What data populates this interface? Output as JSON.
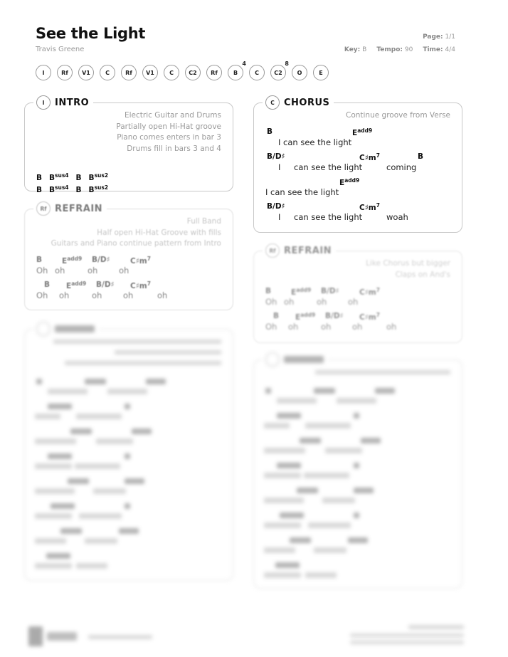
{
  "song": {
    "title": "See the Light",
    "artist": "Travis Greene"
  },
  "meta": {
    "page_label": "Page:",
    "page_value": "1/1",
    "key_label": "Key:",
    "key_value": "B",
    "tempo_label": "Tempo:",
    "tempo_value": "90",
    "time_label": "Time:",
    "time_value": "4/4"
  },
  "roadmap": [
    {
      "label": "I",
      "repeat": ""
    },
    {
      "label": "Rf",
      "repeat": ""
    },
    {
      "label": "V1",
      "repeat": ""
    },
    {
      "label": "C",
      "repeat": ""
    },
    {
      "label": "Rf",
      "repeat": ""
    },
    {
      "label": "V1",
      "repeat": ""
    },
    {
      "label": "C",
      "repeat": ""
    },
    {
      "label": "C2",
      "repeat": ""
    },
    {
      "label": "Rf",
      "repeat": ""
    },
    {
      "label": "B",
      "repeat": "4"
    },
    {
      "label": "C",
      "repeat": ""
    },
    {
      "label": "C2",
      "repeat": "8"
    },
    {
      "label": "O",
      "repeat": ""
    },
    {
      "label": "E",
      "repeat": ""
    }
  ],
  "sections": {
    "intro": {
      "badge": "I",
      "title": "INTRO",
      "notes": [
        "Electric Guitar and Drums",
        "Partially open Hi-Hat groove",
        "Piano comes enters in bar 3",
        "Drums fill in bars 3 and 4"
      ],
      "chord_rows": [
        [
          {
            "root": "B",
            "ext": ""
          },
          {
            "root": "B",
            "ext": "sus4"
          },
          {
            "root": "B",
            "ext": ""
          },
          {
            "root": "B",
            "ext": "sus2"
          }
        ],
        [
          {
            "root": "B",
            "ext": ""
          },
          {
            "root": "B",
            "ext": "sus4"
          },
          {
            "root": "B",
            "ext": ""
          },
          {
            "root": "B",
            "ext": "sus2"
          }
        ]
      ]
    },
    "chorus": {
      "badge": "C",
      "title": "CHORUS",
      "notes": [
        "Continue groove from Verse"
      ],
      "lines": [
        {
          "chords": [
            {
              "root": "B",
              "ext": ""
            },
            {
              "root": "E",
              "ext": "add9"
            }
          ],
          "lyrics": [
            "I can see the light"
          ]
        },
        {
          "chords": [
            {
              "root": "B/D♯",
              "ext": ""
            },
            {
              "root": "C♯m",
              "ext": "7"
            },
            {
              "root": "B",
              "ext": ""
            }
          ],
          "lyrics": [
            "I",
            "can see the light",
            "coming"
          ]
        },
        {
          "chords": [
            {
              "root": "E",
              "ext": "add9"
            }
          ],
          "lyrics": [
            "I can see the light"
          ]
        },
        {
          "chords": [
            {
              "root": "B/D♯",
              "ext": ""
            },
            {
              "root": "C♯m",
              "ext": "7"
            }
          ],
          "lyrics": [
            "I",
            "can see the light",
            "woah"
          ]
        }
      ]
    },
    "refrain1": {
      "badge": "Rf",
      "title": "REFRAIN",
      "notes": [
        "Full Band",
        "Half open Hi-Hat Groove with fills",
        "Guitars and Piano continue pattern from Intro"
      ],
      "lines": [
        {
          "chords": [
            {
              "root": "B",
              "ext": ""
            },
            {
              "root": "E",
              "ext": "add9"
            },
            {
              "root": "B/D♯",
              "ext": ""
            },
            {
              "root": "C♯m",
              "ext": "7"
            }
          ],
          "lyrics": [
            "Oh",
            "oh",
            "oh",
            "oh"
          ]
        },
        {
          "chords": [
            {
              "root": "B",
              "ext": ""
            },
            {
              "root": "E",
              "ext": "add9"
            },
            {
              "root": "B/D♯",
              "ext": ""
            },
            {
              "root": "C♯m",
              "ext": "7"
            }
          ],
          "lyrics": [
            "Oh",
            "oh",
            "oh",
            "oh",
            "oh"
          ]
        }
      ]
    },
    "refrain2": {
      "badge": "Rf",
      "title": "REFRAIN",
      "notes": [
        "Like Chorus but bigger",
        "Claps on And's"
      ],
      "lines": [
        {
          "chords": [
            {
              "root": "B",
              "ext": ""
            },
            {
              "root": "E",
              "ext": "add9"
            },
            {
              "root": "B/D♯",
              "ext": ""
            },
            {
              "root": "C♯m",
              "ext": "7"
            }
          ],
          "lyrics": [
            "Oh",
            "oh",
            "oh",
            "oh"
          ]
        },
        {
          "chords": [
            {
              "root": "B",
              "ext": ""
            },
            {
              "root": "E",
              "ext": "add9"
            },
            {
              "root": "B/D♯",
              "ext": ""
            },
            {
              "root": "C♯m",
              "ext": "7"
            }
          ],
          "lyrics": [
            "Oh",
            "oh",
            "oh",
            "oh",
            "oh"
          ]
        }
      ]
    }
  }
}
